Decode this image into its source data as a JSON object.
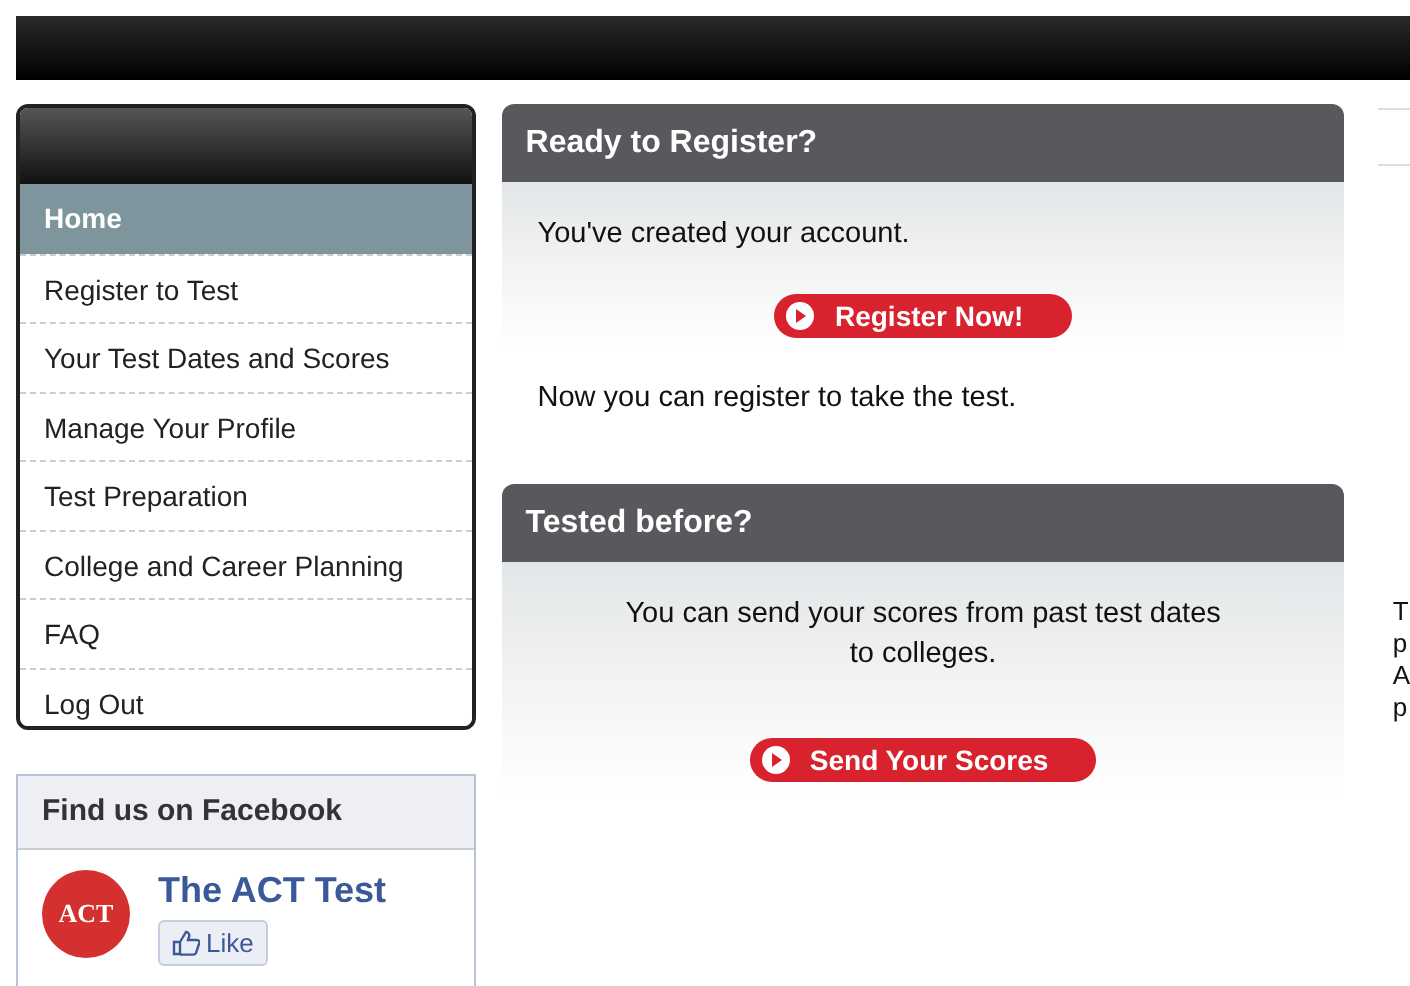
{
  "nav": {
    "items": [
      {
        "label": "Home",
        "selected": true
      },
      {
        "label": "Register to Test",
        "selected": false
      },
      {
        "label": "Your Test Dates and Scores",
        "selected": false
      },
      {
        "label": "Manage Your Profile",
        "selected": false
      },
      {
        "label": "Test Preparation",
        "selected": false
      },
      {
        "label": "College and Career Planning",
        "selected": false
      },
      {
        "label": "FAQ",
        "selected": false
      },
      {
        "label": "Log Out",
        "selected": false
      }
    ]
  },
  "facebook": {
    "title": "Find us on Facebook",
    "page_name": "The ACT Test",
    "logo_text": "ACT",
    "like": "Like"
  },
  "panels": [
    {
      "title": "Ready to Register?",
      "top_text": "You've created your account.",
      "button": "Register Now!",
      "bottom_text": "Now you can register to take the test."
    },
    {
      "title": "Tested before?",
      "top_text": "You can send your scores from past test dates to colleges.",
      "button": "Send Your Scores"
    }
  ],
  "right_column": {
    "cut_lines": [
      "T",
      "p",
      "A",
      "p"
    ]
  }
}
